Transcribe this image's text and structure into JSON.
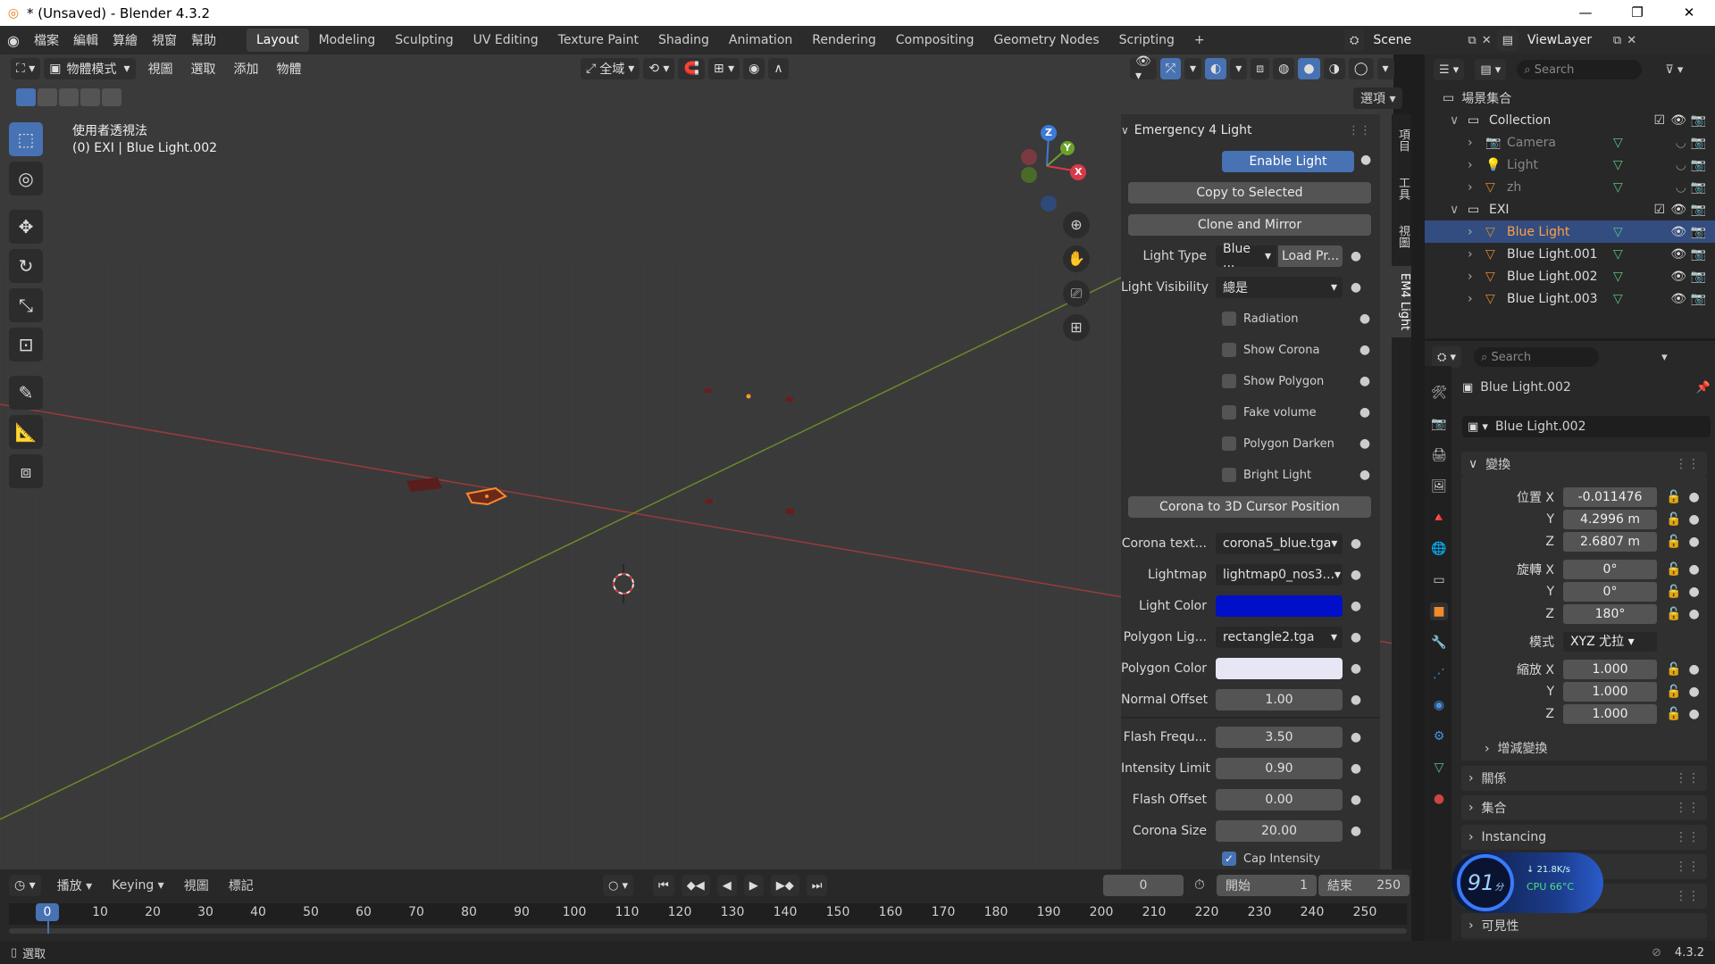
{
  "titlebar": {
    "title": "* (Unsaved) - Blender 4.3.2",
    "minimize": "—",
    "maximize": "❐",
    "close": "✕"
  },
  "menu": [
    "檔案",
    "編輯",
    "算繪",
    "視窗",
    "幫助"
  ],
  "workspaces": [
    "Layout",
    "Modeling",
    "Sculpting",
    "UV Editing",
    "Texture Paint",
    "Shading",
    "Animation",
    "Rendering",
    "Compositing",
    "Geometry Nodes",
    "Scripting",
    "+"
  ],
  "scene": {
    "scene_name": "Scene",
    "viewlayer": "ViewLayer"
  },
  "viewport_header": {
    "mode": "物體模式",
    "menus": [
      "視圖",
      "選取",
      "添加",
      "物體"
    ],
    "orientation": "全域",
    "options": "選項"
  },
  "viewport": {
    "overlay_title": "使用者透視法",
    "overlay_sub": "(0) EXI | Blue Light.002",
    "axis_x": "X",
    "axis_y": "Y",
    "axis_z": "Z"
  },
  "em4": {
    "panel_title": "Emergency 4 Light",
    "enable_light": "Enable Light",
    "copy_to_selected": "Copy to Selected",
    "clone_and_mirror": "Clone and Mirror",
    "light_type_label": "Light Type",
    "light_type_value": "Blue ...",
    "load_preset": "Load Pr...",
    "light_visibility_label": "Light Visibility",
    "light_visibility_value": "總是",
    "checks": [
      {
        "label": "Radiation",
        "checked": false
      },
      {
        "label": "Show Corona",
        "checked": false
      },
      {
        "label": "Show Polygon",
        "checked": false
      },
      {
        "label": "Fake volume",
        "checked": false
      },
      {
        "label": "Polygon Darken",
        "checked": false
      },
      {
        "label": "Bright Light",
        "checked": false
      }
    ],
    "corona_to_cursor": "Corona to 3D Cursor Position",
    "corona_tex_label": "Corona text...",
    "corona_tex_value": "corona5_blue.tga",
    "lightmap_label": "Lightmap",
    "lightmap_value": "lightmap0_nos3...",
    "light_color_label": "Light Color",
    "light_color": "#0010c8",
    "polygon_light_label": "Polygon Lig...",
    "polygon_light_value": "rectangle2.tga",
    "polygon_color_label": "Polygon Color",
    "polygon_color": "#e6e6f5",
    "normal_offset_label": "Normal Offset",
    "normal_offset": "1.00",
    "flash_freq_label": "Flash Frequ...",
    "flash_freq": "3.50",
    "intensity_limit_label": "Intensity Limit",
    "intensity_limit": "0.90",
    "flash_offset_label": "Flash Offset",
    "flash_offset": "0.00",
    "corona_size_label": "Corona Size",
    "corona_size": "20.00",
    "cap_intensity_label": "Cap Intensity"
  },
  "sidebar_tabs": [
    "項目",
    "工具",
    "視圖",
    "EM4 Light"
  ],
  "outliner": {
    "search_placeholder": "Search",
    "root": "場景集合",
    "items": [
      {
        "name": "Collection",
        "indent": 1,
        "type": "collection"
      },
      {
        "name": "Camera",
        "indent": 2,
        "type": "camera",
        "dim": true
      },
      {
        "name": "Light",
        "indent": 2,
        "type": "light",
        "dim": true
      },
      {
        "name": "zh",
        "indent": 2,
        "type": "mesh",
        "dim": true
      },
      {
        "name": "EXI",
        "indent": 1,
        "type": "collection"
      },
      {
        "name": "Blue Light",
        "indent": 2,
        "type": "mesh",
        "selected": true
      },
      {
        "name": "Blue Light.001",
        "indent": 2,
        "type": "mesh"
      },
      {
        "name": "Blue Light.002",
        "indent": 2,
        "type": "mesh"
      },
      {
        "name": "Blue Light.003",
        "indent": 2,
        "type": "mesh"
      }
    ]
  },
  "properties": {
    "search_placeholder": "Search",
    "object_name": "Blue Light.002",
    "object_data_name": "Blue Light.002",
    "transform_title": "變換",
    "location_label": "位置 X",
    "loc_x": "-0.011476",
    "loc_y": "4.2996 m",
    "loc_z": "2.6807 m",
    "rotation_label": "旋轉 X",
    "rot_x": "0°",
    "rot_y": "0°",
    "rot_z": "180°",
    "mode_label": "模式",
    "mode_value": "XYZ 尤拉",
    "scale_label": "縮放 X",
    "scale_x": "1.000",
    "scale_y": "1.000",
    "scale_z": "1.000",
    "y_label": "Y",
    "z_label": "Z",
    "delta_transform": "增減變換",
    "sections": [
      "關係",
      "集合",
      "Instancing",
      "可見性"
    ]
  },
  "timeline": {
    "menus": [
      "播放",
      "Keying",
      "視圖",
      "標記"
    ],
    "current_frame": "0",
    "start_label": "開始",
    "start": "1",
    "end_label": "結束",
    "end": "250",
    "ticks": [
      "0",
      "10",
      "20",
      "30",
      "40",
      "50",
      "60",
      "70",
      "80",
      "90",
      "100",
      "110",
      "120",
      "130",
      "140",
      "150",
      "160",
      "170",
      "180",
      "190",
      "200",
      "210",
      "220",
      "230",
      "240",
      "250"
    ]
  },
  "statusbar": {
    "left": "選取",
    "version": "4.3.2"
  },
  "overlay_widget": {
    "percent": "91",
    "unit": "分",
    "net": "21.8K/s",
    "cpu": "CPU 66°C"
  }
}
